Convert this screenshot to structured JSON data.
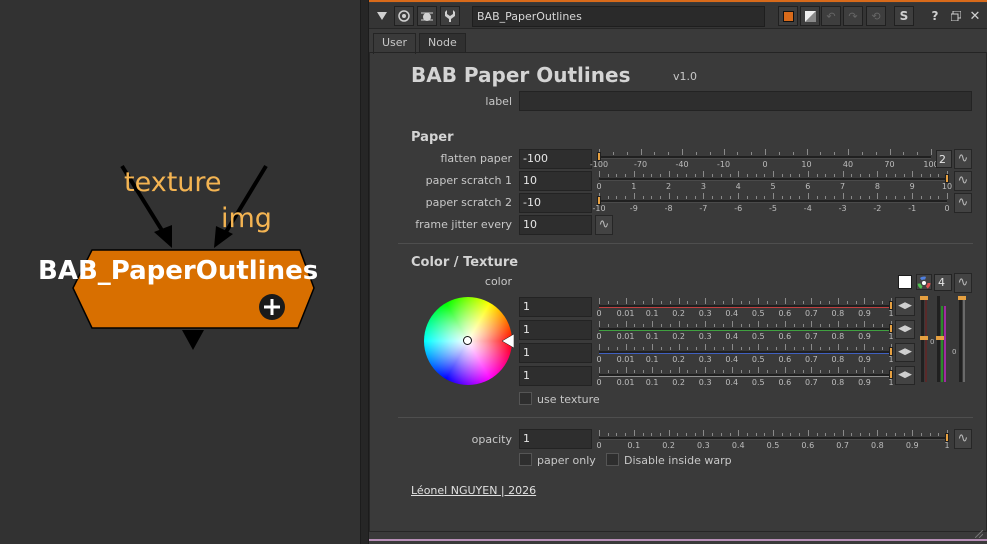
{
  "graph": {
    "inputs": [
      "texture",
      "img"
    ],
    "node_name": "BAB_PaperOutlines",
    "node_color": "#d86f00"
  },
  "toolbar": {
    "node_name": "BAB_PaperOutlines",
    "icons": [
      "collapse-triangle-icon",
      "target-icon",
      "bug-icon",
      "wrench-icon",
      "orange-swatch-icon",
      "split-swatch-icon",
      "undo-icon",
      "redo-icon",
      "revert-icon",
      "script-icon",
      "help-icon",
      "float-icon",
      "close-icon"
    ],
    "s_label": "S",
    "help_label": "?"
  },
  "tabs": [
    "User",
    "Node"
  ],
  "header": {
    "title": "BAB Paper Outlines",
    "version": "v1.0",
    "label_caption": "label",
    "label_value": ""
  },
  "paper": {
    "section": "Paper",
    "flatten": {
      "label": "flatten paper",
      "value": "-100",
      "ticks": [
        "-100",
        "-70",
        "-40",
        "-10",
        "0",
        "10",
        "40",
        "70",
        "100"
      ],
      "badge": "2"
    },
    "scratch1": {
      "label": "paper scratch 1",
      "value": "10",
      "ticks": [
        "0",
        "1",
        "2",
        "3",
        "4",
        "5",
        "6",
        "7",
        "8",
        "9",
        "10"
      ]
    },
    "scratch2": {
      "label": "paper scratch 2",
      "value": "-10",
      "ticks": [
        "-10",
        "-9",
        "-8",
        "-7",
        "-6",
        "-5",
        "-4",
        "-3",
        "-2",
        "-1",
        "0"
      ]
    },
    "jitter": {
      "label": "frame jitter every",
      "value": "10"
    }
  },
  "color_texture": {
    "section": "Color / Texture",
    "color_label": "color",
    "channel_count": "4",
    "channels": [
      {
        "value": "1",
        "color": "#c04040"
      },
      {
        "value": "1",
        "color": "#40a040"
      },
      {
        "value": "1",
        "color": "#4060c0"
      },
      {
        "value": "1",
        "color": "#909090"
      }
    ],
    "ticks": [
      "0",
      "0.01",
      "0.1",
      "0.2",
      "0.3",
      "0.4",
      "0.5",
      "0.6",
      "0.7",
      "0.8",
      "0.9",
      "1"
    ],
    "use_texture": "use texture"
  },
  "opacity": {
    "label": "opacity",
    "value": "1",
    "ticks": [
      "0",
      "0.1",
      "0.2",
      "0.3",
      "0.4",
      "0.5",
      "0.6",
      "0.7",
      "0.8",
      "0.9",
      "1"
    ],
    "paper_only": "paper only",
    "disable_warp": "Disable inside warp"
  },
  "footer": {
    "credit": "Léonel NGUYEN | 2026"
  },
  "colors": {
    "accent": "#d86a1a",
    "node": "#d86f00",
    "label_orange": "#f4b452"
  }
}
